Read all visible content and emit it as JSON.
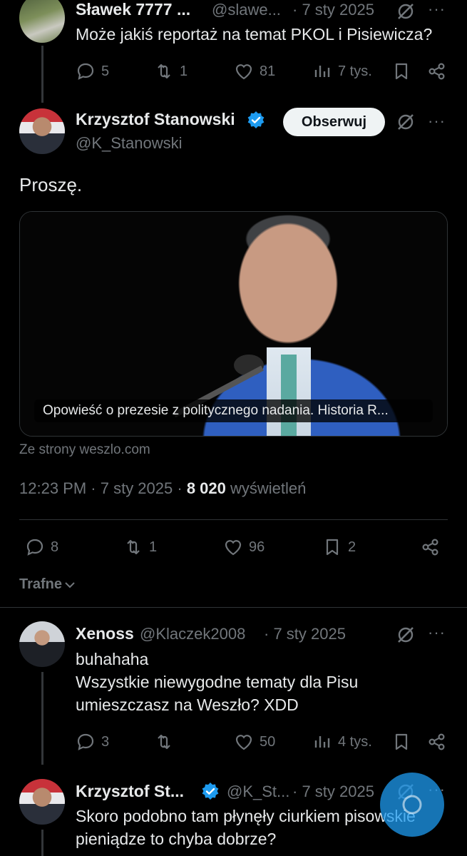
{
  "reply1": {
    "name": "Sławek 7777 ...",
    "handle": "@slawe...",
    "date": "· 7 sty 2025",
    "text": "Może jakiś reportaż na temat PKOL i Pisiewicza?",
    "replies": "5",
    "reposts": "1",
    "likes": "81",
    "views": "7 tys."
  },
  "main": {
    "name": "Krzysztof Stanowski",
    "handle": "@K_Stanowski",
    "follow_label": "Obserwuj",
    "text": "Proszę.",
    "card_title": "Opowieść o prezesie z politycznego nadania. Historia R...",
    "card_source": "Ze strony weszlo.com",
    "time": "12:23 PM",
    "date": "· 7 sty 2025 ·",
    "views_count": "8 020",
    "views_label": "wyświetleń",
    "replies": "8",
    "reposts": "1",
    "likes": "96",
    "bookmarks": "2",
    "sort_label": "Trafne"
  },
  "reply2": {
    "name": "Xenoss",
    "handle": "@Klaczek2008",
    "date": "· 7 sty 2025",
    "text_line1": "buhahaha",
    "text_line2": "Wszystkie niewygodne tematy dla Pisu",
    "text_line3": "umieszczasz na Weszło? XDD",
    "replies": "3",
    "reposts": "",
    "likes": "50",
    "views": "4 tys."
  },
  "reply3": {
    "name": "Krzysztof St...",
    "handle": "@K_St...",
    "date": "· 7 sty 2025",
    "text_line1": "Skoro podobno tam płynęły ciurkiem pisowskie",
    "text_line2": "pieniądze to chyba dobrze?"
  },
  "more_label": "···",
  "colors": {
    "background": "#000000",
    "text": "#e7e9ea",
    "muted": "#71767b",
    "verified": "#1d9bf0",
    "follow_bg": "#eff3f4",
    "fab": "#1d9bf0"
  }
}
